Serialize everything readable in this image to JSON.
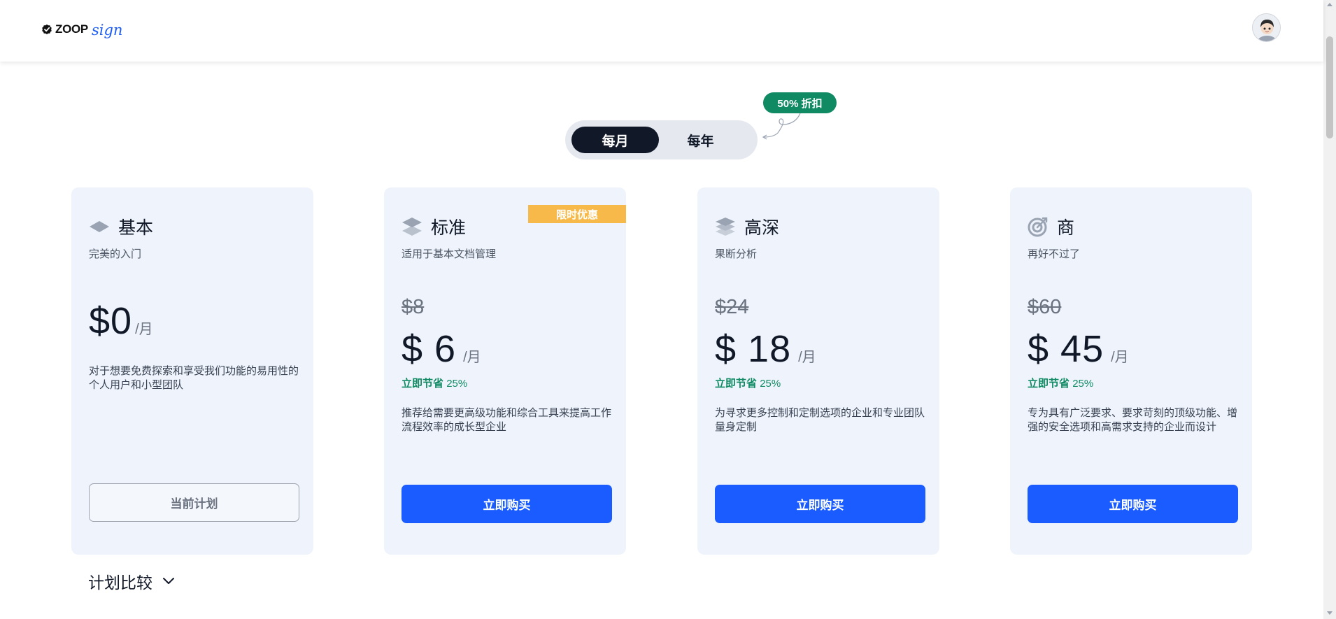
{
  "header": {
    "logo_wordmark": "ZOOP",
    "logo_script": "sign"
  },
  "billing": {
    "monthly_label": "每月",
    "yearly_label": "每年",
    "discount_badge": "50% 折扣",
    "selected": "monthly"
  },
  "plans": [
    {
      "name": "基本",
      "tagline": "完美的入门",
      "price_symbol": "$",
      "price": "0",
      "unit": "/月",
      "description": "对于想要免费探索和享受我们功能的易用性的个人用户和小型团队",
      "cta": "当前计划",
      "icon": "diamond-icon"
    },
    {
      "name": "标准",
      "tagline": "适用于基本文档管理",
      "original_price": "$8",
      "price_symbol": "$",
      "price": "6",
      "unit": "/月",
      "savings_label": "立即节省",
      "savings_value": "25%",
      "description": "推荐给需要更高级功能和综合工具来提高工作流程效率的成长型企业",
      "cta": "立即购买",
      "ribbon": "限时优惠",
      "icon": "layers-icon"
    },
    {
      "name": "高深",
      "tagline": "果断分析",
      "original_price": "$24",
      "price_symbol": "$",
      "price": "18",
      "unit": "/月",
      "savings_label": "立即节省",
      "savings_value": "25%",
      "description": "为寻求更多控制和定制选项的企业和专业团队量身定制",
      "cta": "立即购买",
      "icon": "stack-icon"
    },
    {
      "name": "商",
      "tagline": "再好不过了",
      "original_price": "$60",
      "price_symbol": "$",
      "price": "45",
      "unit": "/月",
      "savings_label": "立即节省",
      "savings_value": "25%",
      "description": "专为具有广泛要求、要求苛刻的顶级功能、增强的安全选项和高需求支持的企业而设计",
      "cta": "立即购买",
      "icon": "target-icon"
    }
  ],
  "compare": {
    "label": "计划比较"
  },
  "colors": {
    "primary": "#1a5cff",
    "success": "#0f8a63",
    "ribbon": "#f6b94a",
    "card_bg": "#eff4fc",
    "toggle_active": "#111827"
  }
}
